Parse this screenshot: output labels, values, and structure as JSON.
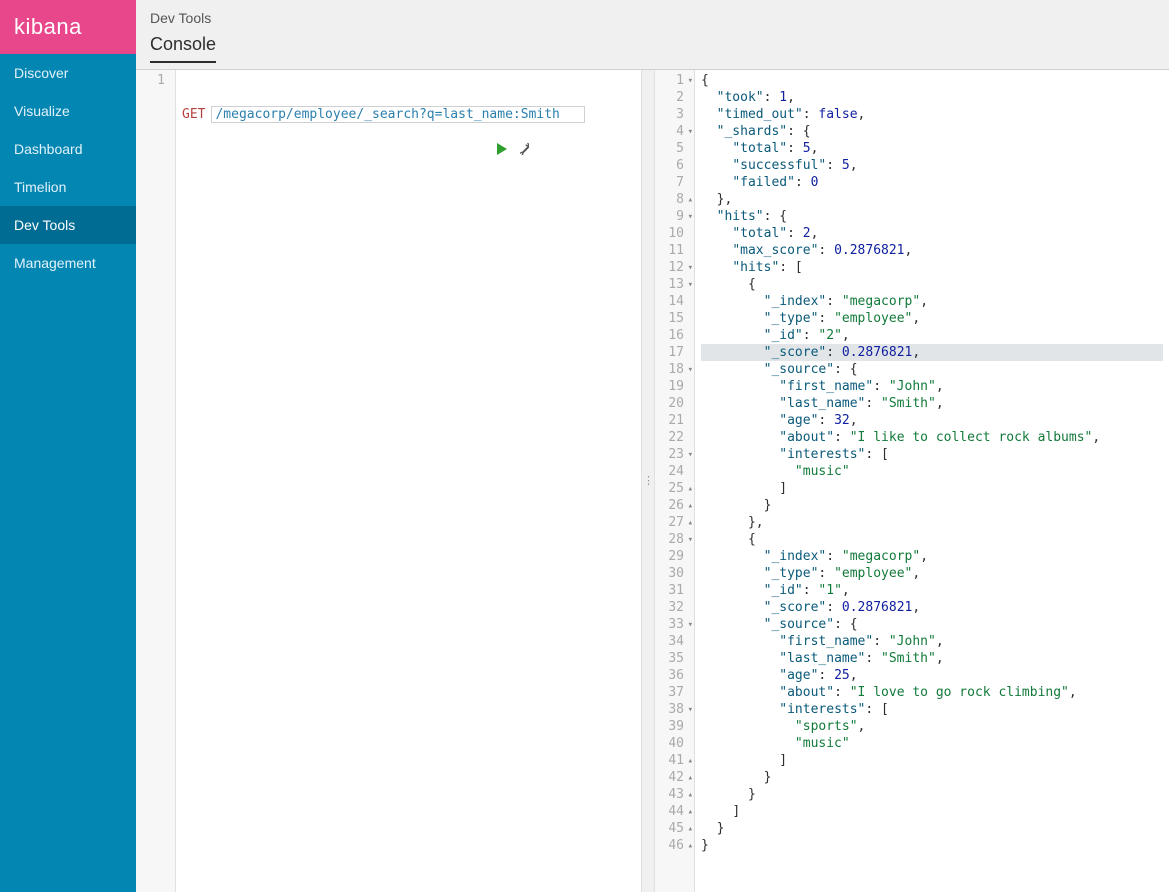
{
  "brand": "kibana",
  "sidebar": {
    "items": [
      {
        "label": "Discover"
      },
      {
        "label": "Visualize"
      },
      {
        "label": "Dashboard"
      },
      {
        "label": "Timelion"
      },
      {
        "label": "Dev Tools",
        "active": true
      },
      {
        "label": "Management"
      }
    ]
  },
  "header": {
    "breadcrumb": "Dev Tools",
    "tabs": [
      {
        "label": "Console",
        "active": true
      }
    ]
  },
  "request": {
    "method": "GET",
    "url": "/megacorp/employee/_search?q=last_name:Smith"
  },
  "response": {
    "highlighted_line": 17,
    "lines": [
      {
        "n": 1,
        "fold": "▾",
        "indent": 0,
        "tokens": [
          {
            "t": "{",
            "c": "punct"
          }
        ]
      },
      {
        "n": 2,
        "indent": 1,
        "tokens": [
          {
            "t": "\"took\"",
            "c": "key"
          },
          {
            "t": ": ",
            "c": "punct"
          },
          {
            "t": "1",
            "c": "num"
          },
          {
            "t": ",",
            "c": "punct"
          }
        ]
      },
      {
        "n": 3,
        "indent": 1,
        "tokens": [
          {
            "t": "\"timed_out\"",
            "c": "key"
          },
          {
            "t": ": ",
            "c": "punct"
          },
          {
            "t": "false",
            "c": "bool"
          },
          {
            "t": ",",
            "c": "punct"
          }
        ]
      },
      {
        "n": 4,
        "fold": "▾",
        "indent": 1,
        "tokens": [
          {
            "t": "\"_shards\"",
            "c": "key"
          },
          {
            "t": ": {",
            "c": "punct"
          }
        ]
      },
      {
        "n": 5,
        "indent": 2,
        "tokens": [
          {
            "t": "\"total\"",
            "c": "key"
          },
          {
            "t": ": ",
            "c": "punct"
          },
          {
            "t": "5",
            "c": "num"
          },
          {
            "t": ",",
            "c": "punct"
          }
        ]
      },
      {
        "n": 6,
        "indent": 2,
        "tokens": [
          {
            "t": "\"successful\"",
            "c": "key"
          },
          {
            "t": ": ",
            "c": "punct"
          },
          {
            "t": "5",
            "c": "num"
          },
          {
            "t": ",",
            "c": "punct"
          }
        ]
      },
      {
        "n": 7,
        "indent": 2,
        "tokens": [
          {
            "t": "\"failed\"",
            "c": "key"
          },
          {
            "t": ": ",
            "c": "punct"
          },
          {
            "t": "0",
            "c": "num"
          }
        ]
      },
      {
        "n": 8,
        "fold": "▴",
        "indent": 1,
        "tokens": [
          {
            "t": "},",
            "c": "punct"
          }
        ]
      },
      {
        "n": 9,
        "fold": "▾",
        "indent": 1,
        "tokens": [
          {
            "t": "\"hits\"",
            "c": "key"
          },
          {
            "t": ": {",
            "c": "punct"
          }
        ]
      },
      {
        "n": 10,
        "indent": 2,
        "tokens": [
          {
            "t": "\"total\"",
            "c": "key"
          },
          {
            "t": ": ",
            "c": "punct"
          },
          {
            "t": "2",
            "c": "num"
          },
          {
            "t": ",",
            "c": "punct"
          }
        ]
      },
      {
        "n": 11,
        "indent": 2,
        "tokens": [
          {
            "t": "\"max_score\"",
            "c": "key"
          },
          {
            "t": ": ",
            "c": "punct"
          },
          {
            "t": "0.2876821",
            "c": "num"
          },
          {
            "t": ",",
            "c": "punct"
          }
        ]
      },
      {
        "n": 12,
        "fold": "▾",
        "indent": 2,
        "tokens": [
          {
            "t": "\"hits\"",
            "c": "key"
          },
          {
            "t": ": [",
            "c": "punct"
          }
        ]
      },
      {
        "n": 13,
        "fold": "▾",
        "indent": 3,
        "tokens": [
          {
            "t": "{",
            "c": "punct"
          }
        ]
      },
      {
        "n": 14,
        "indent": 4,
        "tokens": [
          {
            "t": "\"_index\"",
            "c": "key"
          },
          {
            "t": ": ",
            "c": "punct"
          },
          {
            "t": "\"megacorp\"",
            "c": "str"
          },
          {
            "t": ",",
            "c": "punct"
          }
        ]
      },
      {
        "n": 15,
        "indent": 4,
        "tokens": [
          {
            "t": "\"_type\"",
            "c": "key"
          },
          {
            "t": ": ",
            "c": "punct"
          },
          {
            "t": "\"employee\"",
            "c": "str"
          },
          {
            "t": ",",
            "c": "punct"
          }
        ]
      },
      {
        "n": 16,
        "indent": 4,
        "tokens": [
          {
            "t": "\"_id\"",
            "c": "key"
          },
          {
            "t": ": ",
            "c": "punct"
          },
          {
            "t": "\"2\"",
            "c": "str"
          },
          {
            "t": ",",
            "c": "punct"
          }
        ]
      },
      {
        "n": 17,
        "indent": 4,
        "tokens": [
          {
            "t": "\"_score\"",
            "c": "key"
          },
          {
            "t": ": ",
            "c": "punct"
          },
          {
            "t": "0.2876821",
            "c": "num"
          },
          {
            "t": ",",
            "c": "punct"
          }
        ]
      },
      {
        "n": 18,
        "fold": "▾",
        "indent": 4,
        "tokens": [
          {
            "t": "\"_source\"",
            "c": "key"
          },
          {
            "t": ": {",
            "c": "punct"
          }
        ]
      },
      {
        "n": 19,
        "indent": 5,
        "tokens": [
          {
            "t": "\"first_name\"",
            "c": "key"
          },
          {
            "t": ": ",
            "c": "punct"
          },
          {
            "t": "\"John\"",
            "c": "str"
          },
          {
            "t": ",",
            "c": "punct"
          }
        ]
      },
      {
        "n": 20,
        "indent": 5,
        "tokens": [
          {
            "t": "\"last_name\"",
            "c": "key"
          },
          {
            "t": ": ",
            "c": "punct"
          },
          {
            "t": "\"Smith\"",
            "c": "str"
          },
          {
            "t": ",",
            "c": "punct"
          }
        ]
      },
      {
        "n": 21,
        "indent": 5,
        "tokens": [
          {
            "t": "\"age\"",
            "c": "key"
          },
          {
            "t": ": ",
            "c": "punct"
          },
          {
            "t": "32",
            "c": "num"
          },
          {
            "t": ",",
            "c": "punct"
          }
        ]
      },
      {
        "n": 22,
        "indent": 5,
        "tokens": [
          {
            "t": "\"about\"",
            "c": "key"
          },
          {
            "t": ": ",
            "c": "punct"
          },
          {
            "t": "\"I like to collect rock albums\"",
            "c": "str"
          },
          {
            "t": ",",
            "c": "punct"
          }
        ]
      },
      {
        "n": 23,
        "fold": "▾",
        "indent": 5,
        "tokens": [
          {
            "t": "\"interests\"",
            "c": "key"
          },
          {
            "t": ": [",
            "c": "punct"
          }
        ]
      },
      {
        "n": 24,
        "indent": 6,
        "tokens": [
          {
            "t": "\"music\"",
            "c": "str"
          }
        ]
      },
      {
        "n": 25,
        "fold": "▴",
        "indent": 5,
        "tokens": [
          {
            "t": "]",
            "c": "punct"
          }
        ]
      },
      {
        "n": 26,
        "fold": "▴",
        "indent": 4,
        "tokens": [
          {
            "t": "}",
            "c": "punct"
          }
        ]
      },
      {
        "n": 27,
        "fold": "▴",
        "indent": 3,
        "tokens": [
          {
            "t": "},",
            "c": "punct"
          }
        ]
      },
      {
        "n": 28,
        "fold": "▾",
        "indent": 3,
        "tokens": [
          {
            "t": "{",
            "c": "punct"
          }
        ]
      },
      {
        "n": 29,
        "indent": 4,
        "tokens": [
          {
            "t": "\"_index\"",
            "c": "key"
          },
          {
            "t": ": ",
            "c": "punct"
          },
          {
            "t": "\"megacorp\"",
            "c": "str"
          },
          {
            "t": ",",
            "c": "punct"
          }
        ]
      },
      {
        "n": 30,
        "indent": 4,
        "tokens": [
          {
            "t": "\"_type\"",
            "c": "key"
          },
          {
            "t": ": ",
            "c": "punct"
          },
          {
            "t": "\"employee\"",
            "c": "str"
          },
          {
            "t": ",",
            "c": "punct"
          }
        ]
      },
      {
        "n": 31,
        "indent": 4,
        "tokens": [
          {
            "t": "\"_id\"",
            "c": "key"
          },
          {
            "t": ": ",
            "c": "punct"
          },
          {
            "t": "\"1\"",
            "c": "str"
          },
          {
            "t": ",",
            "c": "punct"
          }
        ]
      },
      {
        "n": 32,
        "indent": 4,
        "tokens": [
          {
            "t": "\"_score\"",
            "c": "key"
          },
          {
            "t": ": ",
            "c": "punct"
          },
          {
            "t": "0.2876821",
            "c": "num"
          },
          {
            "t": ",",
            "c": "punct"
          }
        ]
      },
      {
        "n": 33,
        "fold": "▾",
        "indent": 4,
        "tokens": [
          {
            "t": "\"_source\"",
            "c": "key"
          },
          {
            "t": ": {",
            "c": "punct"
          }
        ]
      },
      {
        "n": 34,
        "indent": 5,
        "tokens": [
          {
            "t": "\"first_name\"",
            "c": "key"
          },
          {
            "t": ": ",
            "c": "punct"
          },
          {
            "t": "\"John\"",
            "c": "str"
          },
          {
            "t": ",",
            "c": "punct"
          }
        ]
      },
      {
        "n": 35,
        "indent": 5,
        "tokens": [
          {
            "t": "\"last_name\"",
            "c": "key"
          },
          {
            "t": ": ",
            "c": "punct"
          },
          {
            "t": "\"Smith\"",
            "c": "str"
          },
          {
            "t": ",",
            "c": "punct"
          }
        ]
      },
      {
        "n": 36,
        "indent": 5,
        "tokens": [
          {
            "t": "\"age\"",
            "c": "key"
          },
          {
            "t": ": ",
            "c": "punct"
          },
          {
            "t": "25",
            "c": "num"
          },
          {
            "t": ",",
            "c": "punct"
          }
        ]
      },
      {
        "n": 37,
        "indent": 5,
        "tokens": [
          {
            "t": "\"about\"",
            "c": "key"
          },
          {
            "t": ": ",
            "c": "punct"
          },
          {
            "t": "\"I love to go rock climbing\"",
            "c": "str"
          },
          {
            "t": ",",
            "c": "punct"
          }
        ]
      },
      {
        "n": 38,
        "fold": "▾",
        "indent": 5,
        "tokens": [
          {
            "t": "\"interests\"",
            "c": "key"
          },
          {
            "t": ": [",
            "c": "punct"
          }
        ]
      },
      {
        "n": 39,
        "indent": 6,
        "tokens": [
          {
            "t": "\"sports\"",
            "c": "str"
          },
          {
            "t": ",",
            "c": "punct"
          }
        ]
      },
      {
        "n": 40,
        "indent": 6,
        "tokens": [
          {
            "t": "\"music\"",
            "c": "str"
          }
        ]
      },
      {
        "n": 41,
        "fold": "▴",
        "indent": 5,
        "tokens": [
          {
            "t": "]",
            "c": "punct"
          }
        ]
      },
      {
        "n": 42,
        "fold": "▴",
        "indent": 4,
        "tokens": [
          {
            "t": "}",
            "c": "punct"
          }
        ]
      },
      {
        "n": 43,
        "fold": "▴",
        "indent": 3,
        "tokens": [
          {
            "t": "}",
            "c": "punct"
          }
        ]
      },
      {
        "n": 44,
        "fold": "▴",
        "indent": 2,
        "tokens": [
          {
            "t": "]",
            "c": "punct"
          }
        ]
      },
      {
        "n": 45,
        "fold": "▴",
        "indent": 1,
        "tokens": [
          {
            "t": "}",
            "c": "punct"
          }
        ]
      },
      {
        "n": 46,
        "fold": "▴",
        "indent": 0,
        "tokens": [
          {
            "t": "}",
            "c": "punct"
          }
        ]
      }
    ]
  }
}
